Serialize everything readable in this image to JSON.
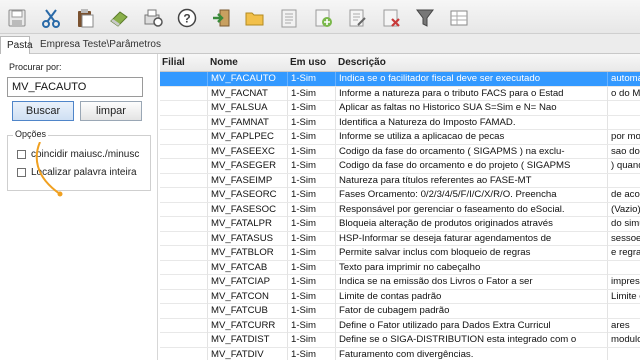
{
  "toolbar": {
    "buttons": [
      {
        "name": "save-icon",
        "color": "#e8e8e8"
      },
      {
        "name": "cut-icon",
        "color": "#2a6aa8"
      },
      {
        "name": "paste-icon",
        "color": "#6b4a2a"
      },
      {
        "name": "eraser-icon",
        "color": "#6a8a3a"
      },
      {
        "name": "print-preview-icon",
        "color": "#666666"
      },
      {
        "name": "help-icon",
        "color": "#444444"
      },
      {
        "name": "exit-icon",
        "color": "#3a8a3a"
      },
      {
        "name": "open-folder-icon",
        "color": "#e9b83a"
      },
      {
        "name": "form-icon",
        "color": "#9a9a9a"
      },
      {
        "name": "new-document-icon",
        "color": "#7ab84a"
      },
      {
        "name": "edit-document-icon",
        "color": "#9a9a9a"
      },
      {
        "name": "delete-document-icon",
        "color": "#c83a3a"
      },
      {
        "name": "filter-icon",
        "color": "#666666"
      },
      {
        "name": "grid-options-icon",
        "color": "#888888"
      }
    ]
  },
  "tabs": {
    "pasta": "Pasta",
    "empresa": "Empresa Teste\\Parâmetros"
  },
  "search": {
    "label": "Procurar por:",
    "value": "MV_FACAUTO",
    "buscar": "Buscar",
    "limpar": "limpar"
  },
  "opcoes": {
    "title": "Opções",
    "option1": "coincidir maiusc./minusc",
    "option2": "Localizar palavra inteira",
    "option1_checked": false,
    "option2_checked": false
  },
  "grid": {
    "headers": {
      "filial": "Filial",
      "nome": "Nome",
      "uso": "Em uso",
      "desc": "Descrição"
    },
    "selected_index": 0,
    "rows": [
      {
        "filial": "",
        "nome": "MV_FACAUTO",
        "uso": "1-Sim",
        "desc": "Indica se o facilitador fiscal deve ser executado",
        "extra": "automa"
      },
      {
        "filial": "",
        "nome": "MV_FACNAT",
        "uso": "1-Sim",
        "desc": "Informe a natureza para o tributo FACS para o Estad",
        "extra": "o do Ma"
      },
      {
        "filial": "",
        "nome": "MV_FALSUA",
        "uso": "1-Sim",
        "desc": "Aplicar as faltas no Historico SUA S=Sim e N= Nao",
        "extra": ""
      },
      {
        "filial": "",
        "nome": "MV_FAMNAT",
        "uso": "1-Sim",
        "desc": "Identifica a Natureza do Imposto FAMAD.",
        "extra": ""
      },
      {
        "filial": "",
        "nome": "MV_FAPLPEC",
        "uso": "1-Sim",
        "desc": "Informe se utiliza a aplicacao de pecas",
        "extra": "por mo"
      },
      {
        "filial": "",
        "nome": "MV_FASEEXC",
        "uso": "1-Sim",
        "desc": "Codigo da fase do orcamento ( SIGAPMS ) na exclu-",
        "extra": "sao do"
      },
      {
        "filial": "",
        "nome": "MV_FASEGER",
        "uso": "1-Sim",
        "desc": "Codigo da fase do orcamento e do projeto ( SIGAPMS",
        "extra": ") quand"
      },
      {
        "filial": "",
        "nome": "MV_FASEIMP",
        "uso": "1-Sim",
        "desc": "Natureza para títulos referentes ao FASE-MT",
        "extra": ""
      },
      {
        "filial": "",
        "nome": "MV_FASEORC",
        "uso": "1-Sim",
        "desc": "Fases Orcamento: 0/2/3/4/5/F/I/C/X/R/O. Preencha",
        "extra": "de acor"
      },
      {
        "filial": "",
        "nome": "MV_FASESOC",
        "uso": "1-Sim",
        "desc": "Responsável por gerenciar o faseamento do eSocial.",
        "extra": "(Vazio)"
      },
      {
        "filial": "",
        "nome": "MV_FATALPR",
        "uso": "1-Sim",
        "desc": "Bloqueia alteração de produtos originados através",
        "extra": "do simu"
      },
      {
        "filial": "",
        "nome": "MV_FATASUS",
        "uso": "1-Sim",
        "desc": "HSP-Informar se deseja faturar agendamentos de",
        "extra": "sessoes"
      },
      {
        "filial": "",
        "nome": "MV_FATBLOR",
        "uso": "1-Sim",
        "desc": "Permite salvar inclus com bloqueio de regras",
        "extra": "e regra"
      },
      {
        "filial": "",
        "nome": "MV_FATCAB",
        "uso": "1-Sim",
        "desc": "Texto para imprimir no cabeçalho",
        "extra": ""
      },
      {
        "filial": "",
        "nome": "MV_FATCIAP",
        "uso": "1-Sim",
        "desc": "Indica se na emissão dos Livros o Fator a ser",
        "extra": "impress"
      },
      {
        "filial": "",
        "nome": "MV_FATCON",
        "uso": "1-Sim",
        "desc": "Limite de contas padrão",
        "extra": "Limite o"
      },
      {
        "filial": "",
        "nome": "MV_FATCUB",
        "uso": "1-Sim",
        "desc": "Fator de cubagem padrão",
        "extra": ""
      },
      {
        "filial": "",
        "nome": "MV_FATCURR",
        "uso": "1-Sim",
        "desc": "Define o Fator utilizado para Dados Extra Curricul",
        "extra": "ares"
      },
      {
        "filial": "",
        "nome": "MV_FATDIST",
        "uso": "1-Sim",
        "desc": "Define se o SIGA-DISTRIBUTION esta integrado com o",
        "extra": "modulo"
      },
      {
        "filial": "",
        "nome": "MV_FATDIV",
        "uso": "1-Sim",
        "desc": "Faturamento com divergências.",
        "extra": ""
      },
      {
        "filial": "",
        "nome": "MV_FATEDIP",
        "uso": "1-Sim",
        "desc": "Determina que a pesquisa do Produto é realizada",
        "extra": "de form"
      }
    ]
  }
}
